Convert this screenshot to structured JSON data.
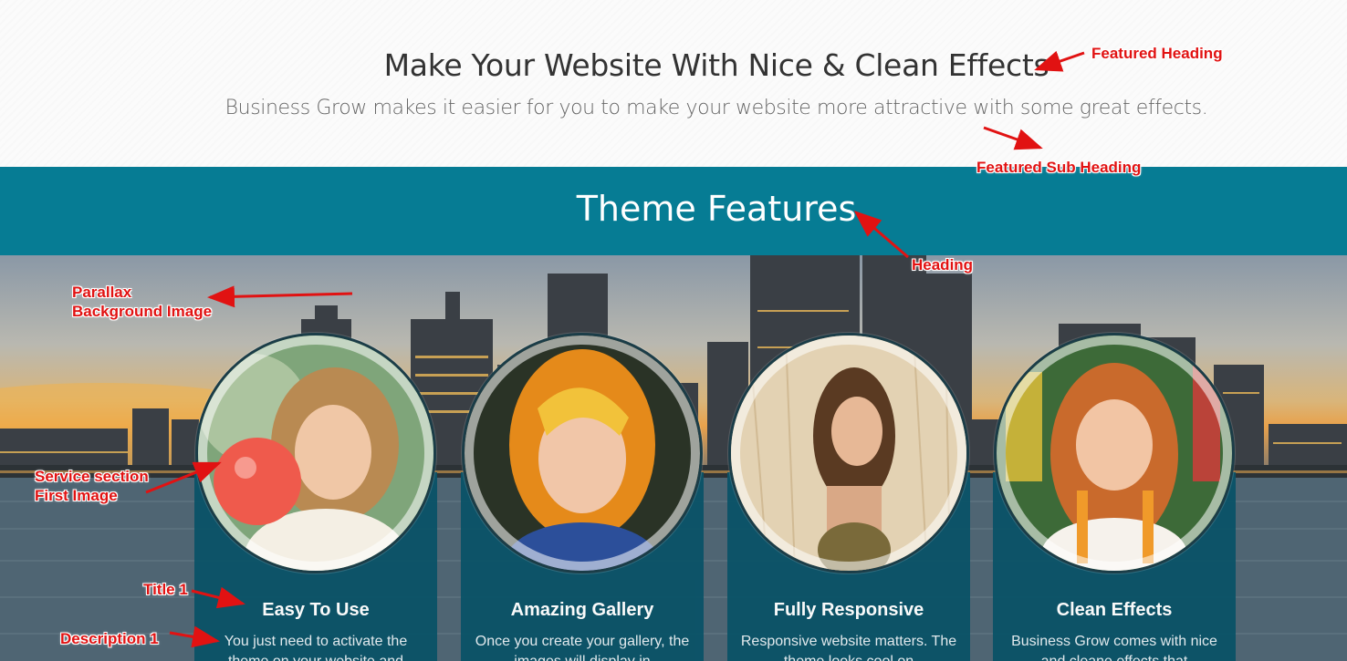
{
  "featured": {
    "heading": "Make Your Website With Nice & Clean Effects",
    "sub_heading": "Business Grow makes it easier for you to make your website more attractive with some great effects."
  },
  "features": {
    "heading": "Theme Features"
  },
  "services": [
    {
      "title": "Easy To Use",
      "description": "You just need to activate the theme on your website and"
    },
    {
      "title": "Amazing Gallery",
      "description": "Once you create your gallery, the images will display in"
    },
    {
      "title": "Fully Responsive",
      "description": "Responsive website matters. The theme looks cool on"
    },
    {
      "title": "Clean Effects",
      "description": "Business Grow comes with nice and cleane effects that"
    }
  ],
  "annotations": {
    "featured_heading": "Featured Heading",
    "featured_sub_heading": "Featured Sub Heading",
    "heading": "Heading",
    "parallax_line1": "Parallax",
    "parallax_line2": "Background Image",
    "service_line1": "Service section",
    "service_line2": "First Image",
    "title": "Title 1",
    "description": "Description 1"
  },
  "colors": {
    "band": "#067c94",
    "card": "#0b5367",
    "annotation": "#e11212"
  }
}
